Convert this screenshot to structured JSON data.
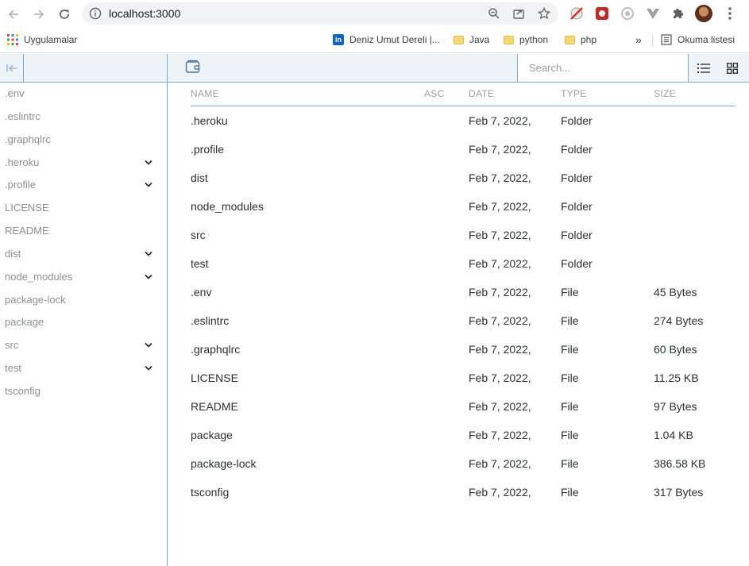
{
  "browser": {
    "url": "localhost:3000",
    "bookmarks": {
      "apps_label": "Uygulamalar",
      "items": [
        {
          "label": "Deniz Umut Dereli |..."
        },
        {
          "label": "Java"
        },
        {
          "label": "python"
        },
        {
          "label": "php"
        }
      ],
      "overflow_label": "»",
      "reading_list_label": "Okuma listesi"
    }
  },
  "sidebar": {
    "items": [
      {
        "label": ".env",
        "expandable": false
      },
      {
        "label": ".eslintrc",
        "expandable": false
      },
      {
        "label": ".graphqlrc",
        "expandable": false
      },
      {
        "label": ".heroku",
        "expandable": true
      },
      {
        "label": ".profile",
        "expandable": true
      },
      {
        "label": "LICENSE",
        "expandable": false
      },
      {
        "label": "README",
        "expandable": false
      },
      {
        "label": "dist",
        "expandable": true
      },
      {
        "label": "node_modules",
        "expandable": true
      },
      {
        "label": "package-lock",
        "expandable": false
      },
      {
        "label": "package",
        "expandable": false
      },
      {
        "label": "src",
        "expandable": true
      },
      {
        "label": "test",
        "expandable": true
      },
      {
        "label": "tsconfig",
        "expandable": false
      }
    ]
  },
  "search": {
    "placeholder": "Search..."
  },
  "table": {
    "columns": {
      "name": "NAME",
      "asc": "ASC",
      "date": "DATE",
      "type": "TYPE",
      "size": "SIZE"
    },
    "rows": [
      {
        "name": ".heroku",
        "date": "Feb 7, 2022,",
        "type": "Folder",
        "size": ""
      },
      {
        "name": ".profile",
        "date": "Feb 7, 2022,",
        "type": "Folder",
        "size": ""
      },
      {
        "name": "dist",
        "date": "Feb 7, 2022,",
        "type": "Folder",
        "size": ""
      },
      {
        "name": "node_modules",
        "date": "Feb 7, 2022,",
        "type": "Folder",
        "size": ""
      },
      {
        "name": "src",
        "date": "Feb 7, 2022,",
        "type": "Folder",
        "size": ""
      },
      {
        "name": "test",
        "date": "Feb 7, 2022,",
        "type": "Folder",
        "size": ""
      },
      {
        "name": ".env",
        "date": "Feb 7, 2022,",
        "type": "File",
        "size": "45 Bytes"
      },
      {
        "name": ".eslintrc",
        "date": "Feb 7, 2022,",
        "type": "File",
        "size": "274 Bytes"
      },
      {
        "name": ".graphqlrc",
        "date": "Feb 7, 2022,",
        "type": "File",
        "size": "60 Bytes"
      },
      {
        "name": "LICENSE",
        "date": "Feb 7, 2022,",
        "type": "File",
        "size": "11.25 KB"
      },
      {
        "name": "README",
        "date": "Feb 7, 2022,",
        "type": "File",
        "size": "97 Bytes"
      },
      {
        "name": "package",
        "date": "Feb 7, 2022,",
        "type": "File",
        "size": "1.04 KB"
      },
      {
        "name": "package-lock",
        "date": "Feb 7, 2022,",
        "type": "File",
        "size": "386.58 KB"
      },
      {
        "name": "tsconfig",
        "date": "Feb 7, 2022,",
        "type": "File",
        "size": "317 Bytes"
      }
    ]
  },
  "colors": {
    "accent_border": "#7fa7c7",
    "header_bg": "#eef3f8"
  }
}
